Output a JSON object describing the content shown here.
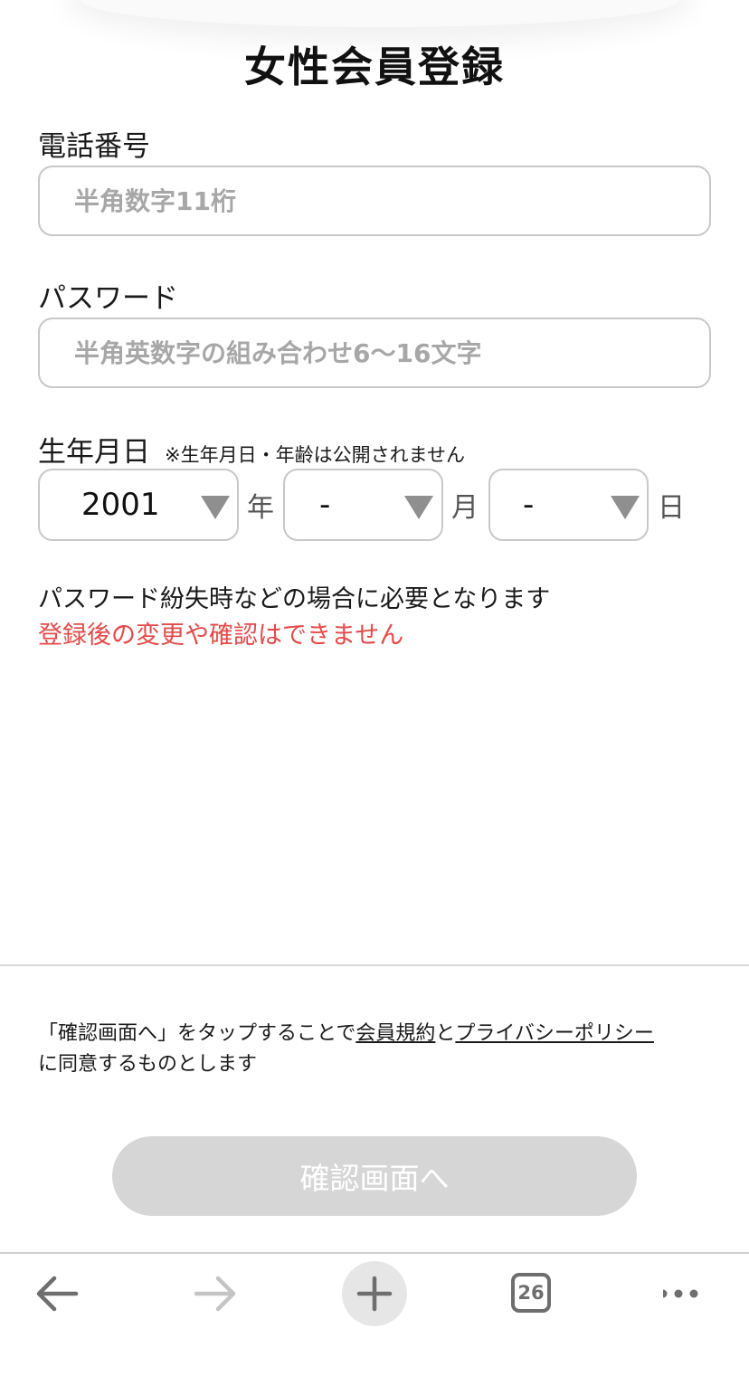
{
  "colors": {
    "accent_red": "#e34a4a",
    "border": "#c8c8c8",
    "placeholder": "#a7a7a7",
    "button_disabled": "#d6d6d6",
    "icon_gray": "#6e6e6e"
  },
  "header": {
    "title": "女性会員登録"
  },
  "form": {
    "phone": {
      "label": "電話番号",
      "placeholder": "半角数字11桁",
      "value": ""
    },
    "password": {
      "label": "パスワード",
      "placeholder": "半角英数字の組み合わせ6〜16文字",
      "value": ""
    },
    "birthday": {
      "label": "生年月日",
      "note": "※生年月日・年齢は公開されません",
      "year": {
        "value": "2001",
        "unit": "年"
      },
      "month": {
        "value": "-",
        "unit": "月"
      },
      "day": {
        "value": "-",
        "unit": "日"
      }
    },
    "help_text": "パスワード紛失時などの場合に必要となります",
    "warning_text": "登録後の変更や確認はできません"
  },
  "terms": {
    "before": "「確認画面へ」をタップすることで",
    "link_terms": "会員規約",
    "middle": "と",
    "link_privacy": "プライバシーポリシー",
    "after": "に同意するものとします"
  },
  "confirm_button": {
    "label": "確認画面へ",
    "enabled": false
  },
  "browser_toolbar": {
    "back_icon": "arrow-left-icon",
    "forward_icon": "arrow-right-icon",
    "new_tab_icon": "plus-icon",
    "tab_count": "26",
    "menu_icon": "more-horizontal-icon"
  }
}
